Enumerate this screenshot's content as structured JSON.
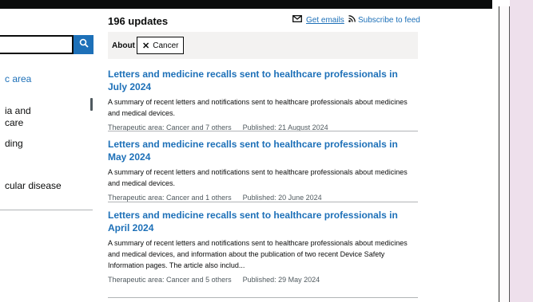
{
  "sidebar": {
    "area_link": "c area",
    "items": [
      "ia and\ncare",
      "ding",
      "cular disease"
    ]
  },
  "header": {
    "update_count": "196 updates",
    "get_emails": "Get emails",
    "subscribe_feed": "Subscribe to feed"
  },
  "filters": {
    "about_label": "About",
    "chip_label": "Cancer"
  },
  "results": [
    {
      "title": "Letters and medicine recalls sent to healthcare professionals in July 2024",
      "summary": "A summary of recent letters and notifications sent to healthcare professionals about medicines and medical devices.",
      "area": "Therapeutic area: Cancer and 7 others",
      "published": "Published: 21 August 2024"
    },
    {
      "title": "Letters and medicine recalls sent to healthcare professionals in May 2024",
      "summary": "A summary of recent letters and notifications sent to healthcare professionals about medicines and medical devices.",
      "area": "Therapeutic area: Cancer and 1 others",
      "published": "Published: 20 June 2024"
    },
    {
      "title": "Letters and medicine recalls sent to healthcare professionals in April 2024",
      "summary": "A summary of recent letters and notifications sent to healthcare professionals about medicines and medical devices, and information about the publication of two recent Device Safety Information pages. The article also includ...",
      "area": "Therapeutic area: Cancer and 5 others",
      "published": "Published: 29 May 2024"
    }
  ],
  "colors": {
    "link": "#1d70b8",
    "text": "#0b0c0c",
    "secondary": "#505a5f",
    "filter_bg": "#f3f2f1"
  }
}
